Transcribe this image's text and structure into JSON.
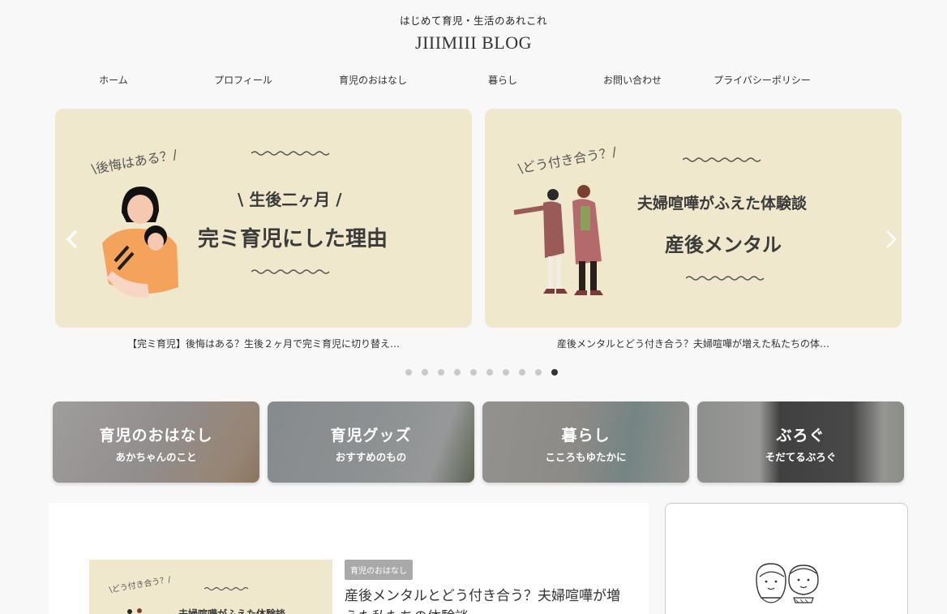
{
  "header": {
    "tagline": "はじめて育児・生活のあれこれ",
    "title": "JIIIMIII BLOG"
  },
  "nav": {
    "items": [
      {
        "label": "ホーム"
      },
      {
        "label": "プロフィール"
      },
      {
        "label": "育児のおはなし"
      },
      {
        "label": "暮らし"
      },
      {
        "label": "お問い合わせ"
      },
      {
        "label": "プライバシーポリシー"
      }
    ]
  },
  "slider": {
    "prev_icon": "chevron-left-icon",
    "next_icon": "chevron-right-icon",
    "slides": [
      {
        "tag": "\\後悔はある？/",
        "line1": "\\ 生後二ヶ月 /",
        "line2": "完ミ育児にした理由",
        "caption": "【完ミ育児】後悔はある？生後２ヶ月で完ミ育児に切り替え…"
      },
      {
        "tag": "\\どう付き合う？/",
        "line1": "夫婦喧嘩がふえた体験談",
        "line2": "産後メンタル",
        "caption": "産後メンタルとどう付き合う？夫婦喧嘩が増えた私たちの体…"
      }
    ],
    "dot_count": 10,
    "active_dot": 9
  },
  "categories": [
    {
      "title": "育児のおはなし",
      "subtitle": "あかちゃんのこと"
    },
    {
      "title": "育児グッズ",
      "subtitle": "おすすめのもの"
    },
    {
      "title": "暮らし",
      "subtitle": "こころもゆたかに"
    },
    {
      "title": "ぶろぐ",
      "subtitle": "そだてるぶろぐ"
    }
  ],
  "latest_post": {
    "thumb_tag": "\\どう付き合う？/",
    "thumb_line1": "夫婦喧嘩がふえた体験談",
    "category": "育児のおはなし",
    "title": "産後メンタルとどう付き合う？夫婦喧嘩が増えた私たちの体験談"
  },
  "colors": {
    "card_bg": "#efe8cd",
    "page_bg": "#f8f8f8",
    "dot_active": "#333333",
    "dot_inactive": "#c9c9c9"
  }
}
